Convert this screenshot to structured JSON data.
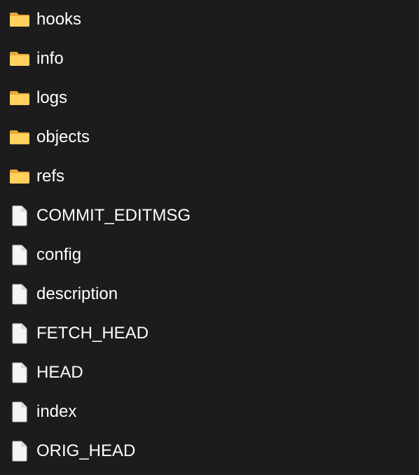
{
  "explorer": {
    "items": [
      {
        "name": "hooks",
        "type": "folder",
        "icon": "folder-icon"
      },
      {
        "name": "info",
        "type": "folder",
        "icon": "folder-icon"
      },
      {
        "name": "logs",
        "type": "folder",
        "icon": "folder-icon"
      },
      {
        "name": "objects",
        "type": "folder",
        "icon": "folder-icon"
      },
      {
        "name": "refs",
        "type": "folder",
        "icon": "folder-icon"
      },
      {
        "name": "COMMIT_EDITMSG",
        "type": "file",
        "icon": "file-icon"
      },
      {
        "name": "config",
        "type": "file",
        "icon": "file-icon"
      },
      {
        "name": "description",
        "type": "file",
        "icon": "file-icon"
      },
      {
        "name": "FETCH_HEAD",
        "type": "file",
        "icon": "file-icon"
      },
      {
        "name": "HEAD",
        "type": "file",
        "icon": "file-icon"
      },
      {
        "name": "index",
        "type": "file",
        "icon": "file-icon"
      },
      {
        "name": "ORIG_HEAD",
        "type": "file",
        "icon": "file-icon"
      }
    ]
  },
  "colors": {
    "background": "#1c1c1c",
    "text": "#ffffff",
    "folder_back": "#e8a93b",
    "folder_front": "#ffd25e",
    "file_body": "#f5f5f5",
    "file_outline": "#c8c8c8"
  }
}
